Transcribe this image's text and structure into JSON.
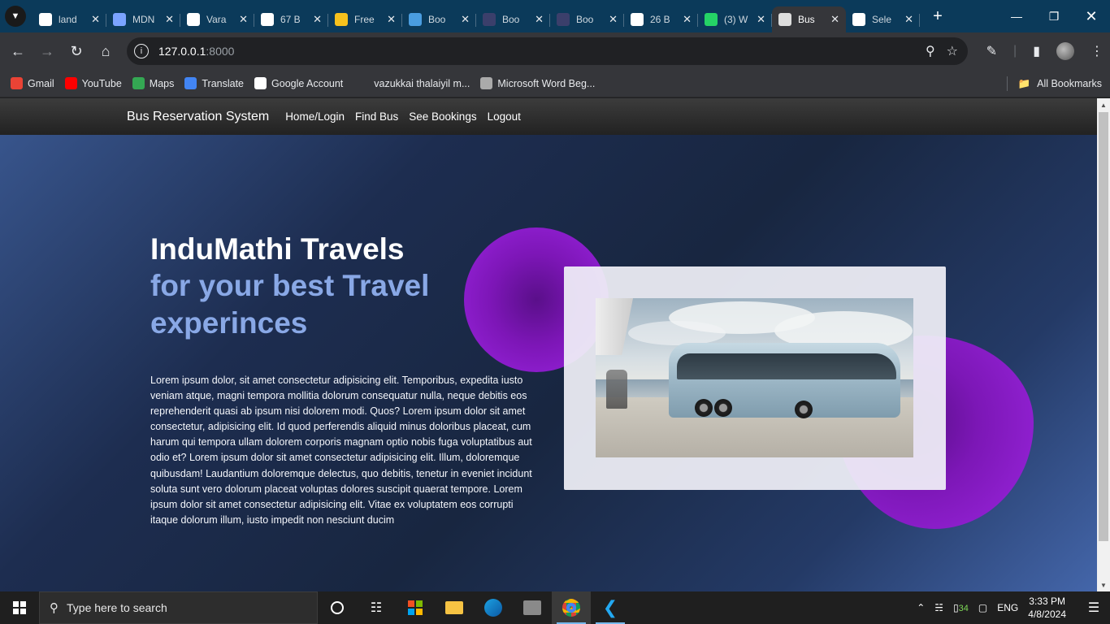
{
  "browser": {
    "tabs": [
      {
        "title": "land",
        "icon": "codepen-icon",
        "color": "#ffffff"
      },
      {
        "title": "MDN",
        "icon": "mdn-icon",
        "color": "#7ba3ff"
      },
      {
        "title": "Vara",
        "icon": "github-icon",
        "color": "#ffffff"
      },
      {
        "title": "67 B",
        "icon": "flaticon-icon",
        "color": "#ffffff"
      },
      {
        "title": "Free",
        "icon": "free-icon",
        "color": "#f7c21d"
      },
      {
        "title": "Boo",
        "icon": "bootstrap-icon",
        "color": "#4a9de0"
      },
      {
        "title": "Boo",
        "icon": "dots-icon",
        "color": "#3b3f6b"
      },
      {
        "title": "Boo",
        "icon": "dots-icon",
        "color": "#3b3f6b"
      },
      {
        "title": "26 B",
        "icon": "flaticon-icon",
        "color": "#ffffff"
      },
      {
        "title": "(3) W",
        "icon": "whatsapp-icon",
        "color": "#25d366"
      },
      {
        "title": "Bus",
        "icon": "globe-icon",
        "color": "#dddddd"
      },
      {
        "title": "Sele",
        "icon": "bus-icon",
        "color": "#ffffff"
      }
    ],
    "url_host": "127.0.0.1",
    "url_port": ":8000",
    "bookmarks": [
      {
        "label": "Gmail",
        "icon": "gmail-icon",
        "color": "#ea4335"
      },
      {
        "label": "YouTube",
        "icon": "youtube-icon",
        "color": "#ff0000"
      },
      {
        "label": "Maps",
        "icon": "maps-icon",
        "color": "#34a853"
      },
      {
        "label": "Translate",
        "icon": "translate-icon",
        "color": "#4285f4"
      },
      {
        "label": "Google Account",
        "icon": "google-icon",
        "color": "#ffffff"
      },
      {
        "label": "vazukkai thalaiyil m...",
        "icon": "",
        "color": ""
      },
      {
        "label": "Microsoft Word Beg...",
        "icon": "globe-icon",
        "color": "#aaaaaa"
      }
    ],
    "all_bookmarks": "All Bookmarks"
  },
  "site": {
    "brand": "Bus Reservation System",
    "nav": [
      "Home/Login",
      "Find Bus",
      "See Bookings",
      "Logout"
    ],
    "hero_title": "InduMathi Travels",
    "hero_subtitle": "for your best Travel experinces",
    "hero_text": "Lorem ipsum dolor, sit amet consectetur adipisicing elit. Temporibus, expedita iusto veniam atque, magni tempora mollitia dolorum consequatur nulla, neque debitis eos reprehenderit quasi ab ipsum nisi dolorem modi. Quos? Lorem ipsum dolor sit amet consectetur, adipisicing elit. Id quod perferendis aliquid minus doloribus placeat, cum harum qui tempora ullam dolorem corporis magnam optio nobis fuga voluptatibus aut odio et? Lorem ipsum dolor sit amet consectetur adipisicing elit. Illum, doloremque quibusdam! Laudantium doloremque delectus, quo debitis, tenetur in eveniet incidunt soluta sunt vero dolorum placeat voluptas dolores suscipit quaerat tempore. Lorem ipsum dolor sit amet consectetur adipisicing elit. Vitae ex voluptatem eos corrupti itaque dolorum illum, iusto impedit non nesciunt ducim",
    "accent_color": "#89a8e6",
    "blob_color": "#9b25df"
  },
  "taskbar": {
    "search_placeholder": "Type here to search",
    "battery": "34",
    "language": "ENG",
    "time": "3:33 PM",
    "date": "4/8/2024"
  }
}
